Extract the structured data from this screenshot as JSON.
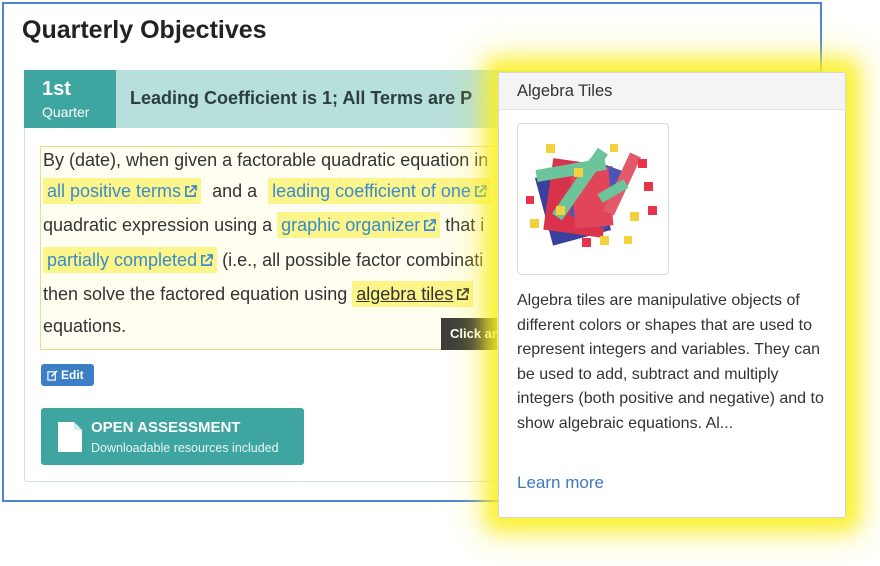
{
  "page": {
    "title": "Quarterly Objectives"
  },
  "quarter": {
    "number": "1st",
    "label": "Quarter"
  },
  "banner": {
    "title": "Leading Coefficient is 1; All Terms are P"
  },
  "objective": {
    "line1_text": "By (date), when given a factorable quadratic equation in",
    "line2_link1": "all positive terms",
    "line2_mid": "and a",
    "line2_link2": "leading coefficient of one",
    "line3_text": "quadratic expression using a",
    "line3_link": "graphic organizer",
    "line3_after": "that i",
    "line4_link": "partially completed",
    "line4_after": "(i.e., all possible factor combinati",
    "line5_text": "then solve the factored equation using",
    "line5_link": "algebra tiles",
    "line6_text": "equations."
  },
  "tooltip": {
    "text": "Click an"
  },
  "edit_button": {
    "label": "Edit",
    "icon": "edit-icon"
  },
  "assessment_button": {
    "title": "OPEN ASSESSMENT",
    "subtitle": "Downloadable resources included",
    "icon": "document-icon"
  },
  "popover": {
    "title": "Algebra Tiles",
    "image": "algebra-tiles-image",
    "body": "Algebra tiles are manipulative objects of different colors or shapes that are used to represent integers and variables. They can be used to add, subtract and multiply integers (both positive and negative) and to show algebraic equations. Al...",
    "link": "Learn more"
  },
  "colors": {
    "teal": "#3fa5a0",
    "banner": "#b7dfdc",
    "highlight": "#fbf58a",
    "link_blue": "#3b8ad0",
    "edit_blue": "#3c7fc4",
    "frame_blue": "#4a86d6",
    "glow_yellow": "#faf01e"
  }
}
